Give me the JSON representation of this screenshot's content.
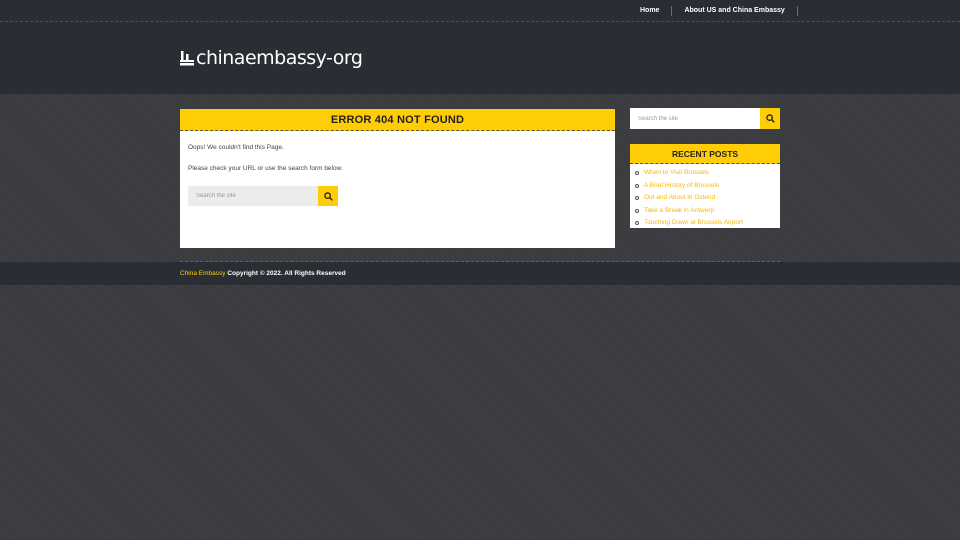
{
  "nav": {
    "items": [
      {
        "label": "Home"
      },
      {
        "label": "About US and China Embassy"
      }
    ]
  },
  "site": {
    "name": "chinaembassy-org",
    "logo_icon": "building-icon"
  },
  "main": {
    "title": "ERROR 404 NOT FOUND",
    "message1": "Oops! We couldn't find this Page.",
    "message2": "Please check your URL or use the search form below.",
    "search": {
      "placeholder": "Search the site",
      "icon": "search-icon"
    }
  },
  "sidebar": {
    "search": {
      "placeholder": "Search the site",
      "icon": "search-icon"
    },
    "recent_posts": {
      "title": "RECENT POSTS",
      "items": [
        {
          "label": "When to Visit Brussels"
        },
        {
          "label": "A Brief History of Brussels"
        },
        {
          "label": "Out and About in Ostend"
        },
        {
          "label": "Take a Break in Antwerp"
        },
        {
          "label": "Touching Down at Brussels Airport"
        }
      ]
    }
  },
  "footer": {
    "brand": "China Embassy",
    "copyright": "Copyright © 2022. All Rights Reserved"
  },
  "colors": {
    "accent": "#ffcd05",
    "dark": "#2a2d33",
    "background": "#3a3c40",
    "link": "#f5b80c"
  }
}
